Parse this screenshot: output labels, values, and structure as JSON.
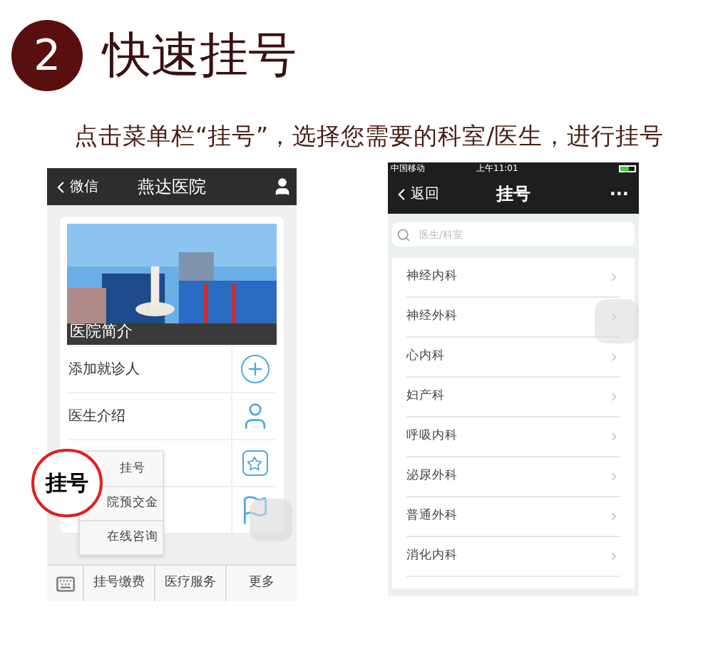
{
  "step": {
    "number": "2",
    "title": "快速挂号"
  },
  "instruction": "点击菜单栏“挂号”，选择您需要的科室/医生，进行挂号",
  "left_phone": {
    "nav": {
      "back": "微信",
      "title": "燕达医院"
    },
    "banner": {
      "caption": "医院简介"
    },
    "rows": [
      {
        "label": "添加就诊人",
        "kind": "plus"
      },
      {
        "label": "医生介绍",
        "kind": "person"
      },
      {
        "kind": "star"
      },
      {
        "kind": "flag"
      }
    ],
    "popup": {
      "items": [
        "挂号",
        "院预交金",
        "在线咨询"
      ]
    },
    "highlight": "挂号",
    "tabbar": [
      "挂号缴费",
      "医疗服务",
      "更多"
    ]
  },
  "right_phone": {
    "status": {
      "carrier": "中国移动",
      "time": "上午11:01"
    },
    "nav": {
      "back": "返回",
      "title": "挂号",
      "more": "···"
    },
    "search": {
      "placeholder": "医生/科室"
    },
    "departments": [
      "神经内科",
      "神经外科",
      "心内科",
      "妇产科",
      "呼吸内科",
      "泌尿外科",
      "普通外科",
      "消化内科"
    ]
  }
}
